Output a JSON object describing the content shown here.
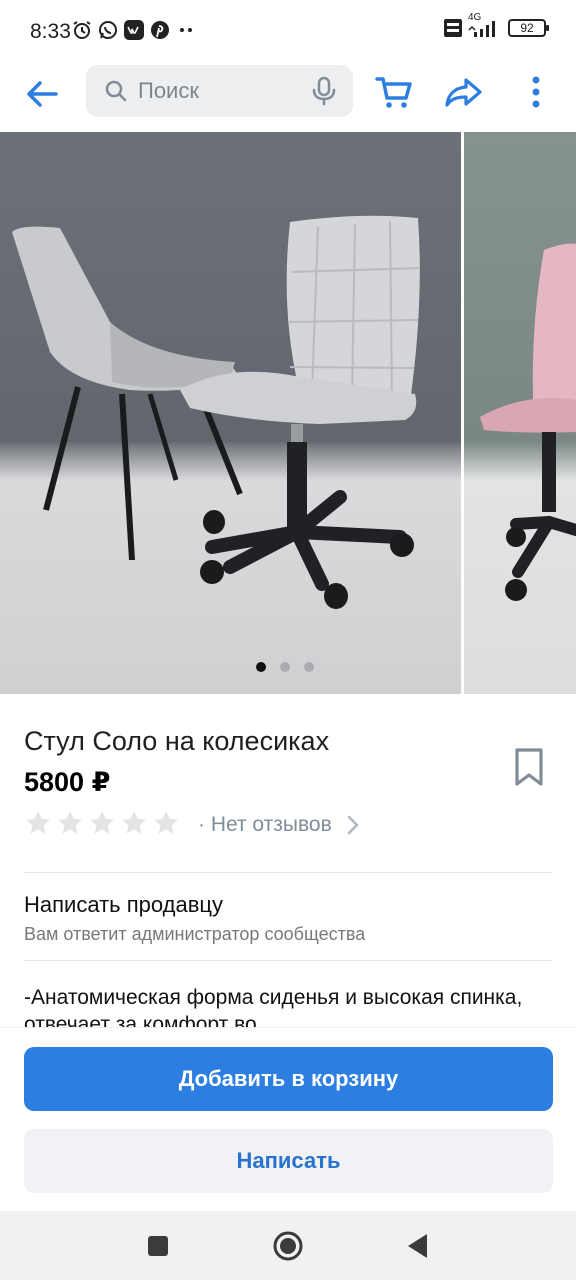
{
  "status_bar": {
    "time": "8:33",
    "battery": "92",
    "network": "4G",
    "icons": [
      "alarm-icon",
      "whatsapp-icon",
      "vk-icon",
      "pinterest-icon",
      "more-dots-icon",
      "volte-icon",
      "signal-icon",
      "battery-icon"
    ]
  },
  "toolbar": {
    "search_placeholder": "Поиск",
    "icons": [
      "back-arrow-icon",
      "search-icon",
      "microphone-icon",
      "cart-icon",
      "share-icon",
      "more-vertical-icon"
    ],
    "accent_color": "#2c7fe0"
  },
  "gallery": {
    "slides_count": 3,
    "active_slide": 1
  },
  "product": {
    "title": "Стул Соло на колесиках",
    "price": "5800 ₽",
    "rating_stars": 0,
    "rating_max": 5,
    "reviews": "· Нет отзывов"
  },
  "seller": {
    "title": "Написать продавцу",
    "subtitle": "Вам ответит администратор сообщества"
  },
  "description": {
    "text": "-Анатомическая форма сиденья и высокая спинка, отвечает за комфорт во"
  },
  "actions": {
    "add_to_cart": "Добавить в корзину",
    "write": "Написать",
    "primary_color": "#2c7fe0"
  },
  "navbar": {
    "icons": [
      "recents-square-icon",
      "home-circle-icon",
      "back-triangle-icon"
    ]
  }
}
